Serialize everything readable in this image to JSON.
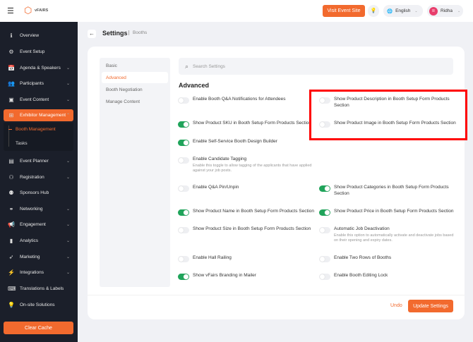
{
  "header": {
    "brand": "vFAIRS",
    "visit_label": "Visit Event Site",
    "language": "English",
    "user_initial": "R",
    "user_name": "Ridha"
  },
  "sidebar": {
    "items": [
      {
        "label": "Overview",
        "icon": "ℹ",
        "chev": false
      },
      {
        "label": "Event Setup",
        "icon": "⚙",
        "chev": false
      },
      {
        "label": "Agenda & Speakers",
        "icon": "📅",
        "chev": true
      },
      {
        "label": "Participants",
        "icon": "👥",
        "chev": true
      },
      {
        "label": "Event Content",
        "icon": "▣",
        "chev": true
      },
      {
        "label": "Exhibitor Management",
        "icon": "⊞",
        "chev": true,
        "active": true
      },
      {
        "label": "Event Planner",
        "icon": "▤",
        "chev": true
      },
      {
        "label": "Registration",
        "icon": "⚇",
        "chev": true
      },
      {
        "label": "Sponsors Hub",
        "icon": "⚉",
        "chev": false
      },
      {
        "label": "Networking",
        "icon": "⚭",
        "chev": true
      },
      {
        "label": "Engagement",
        "icon": "📢",
        "chev": true
      },
      {
        "label": "Analytics",
        "icon": "▮",
        "chev": true
      },
      {
        "label": "Marketing",
        "icon": "➶",
        "chev": true
      },
      {
        "label": "Integrations",
        "icon": "⚡",
        "chev": true
      },
      {
        "label": "Translations & Labels",
        "icon": "⌨",
        "chev": false
      },
      {
        "label": "On-site Solutions",
        "icon": "💡",
        "chev": false
      }
    ],
    "sub": [
      "Booth Management",
      "Tasks"
    ],
    "clear_cache": "Clear Cache"
  },
  "page": {
    "title": "Settings",
    "breadcrumb": "Booths"
  },
  "settings_nav": [
    "Basic",
    "Advanced",
    "Booth Negotiation",
    "Manage Content"
  ],
  "search_placeholder": "Search Settings",
  "section_title": "Advanced",
  "toggles": [
    {
      "label": "Enable Booth Q&A Notifications for Attendees",
      "on": false,
      "col": 0,
      "row": 0
    },
    {
      "label": "Show Product Description in Booth Setup Form Products Section",
      "on": false,
      "col": 1,
      "row": 0
    },
    {
      "label": "Show Product SKU in Booth Setup Form Products Section",
      "on": true,
      "col": 0,
      "row": 1
    },
    {
      "label": "Show Product Image in Booth Setup Form Products Section",
      "on": false,
      "col": 1,
      "row": 1
    },
    {
      "label": "Enable Self-Service Booth Design Builder",
      "on": true,
      "col": 0,
      "row": 2
    },
    {
      "label": "Enable Candidate Tagging",
      "desc": "Enable this toggle to allow tagging of the applicants that have applied against your job posts.",
      "on": false,
      "col": 0,
      "row": 3
    },
    {
      "label": "Enable Q&A Pin/Unpin",
      "on": false,
      "col": 0,
      "row": 4
    },
    {
      "label": "Show Product Categories in Booth Setup Form Products Section",
      "on": true,
      "col": 1,
      "row": 4
    },
    {
      "label": "Show Product Name in Booth Setup Form Products Section",
      "on": true,
      "col": 0,
      "row": 5
    },
    {
      "label": "Show Product Price in Booth Setup Form Products Section",
      "on": true,
      "col": 1,
      "row": 5
    },
    {
      "label": "Show Product Size in Booth Setup Form Products Section",
      "on": false,
      "col": 0,
      "row": 6
    },
    {
      "label": "Automatic Job Deactivation",
      "desc": "Enable this option to automatically activate and deactivate jobs based on their opening and expiry dates.",
      "on": false,
      "col": 1,
      "row": 6
    },
    {
      "label": "Enable Hall Railing",
      "on": false,
      "col": 0,
      "row": 7
    },
    {
      "label": "Enable Two Rows of Booths",
      "on": false,
      "col": 1,
      "row": 7
    },
    {
      "label": "Show vFairs Branding in Mailer",
      "on": true,
      "col": 0,
      "row": 8
    },
    {
      "label": "Enable Booth Editing Lock",
      "on": false,
      "col": 1,
      "row": 8
    }
  ],
  "footer": {
    "undo": "Undo",
    "update": "Update Settings"
  },
  "colors": {
    "accent": "#f26a2e",
    "toggle_on": "#1fa45a",
    "sidebar": "#1b1f2a",
    "highlight": "#ff0000"
  }
}
